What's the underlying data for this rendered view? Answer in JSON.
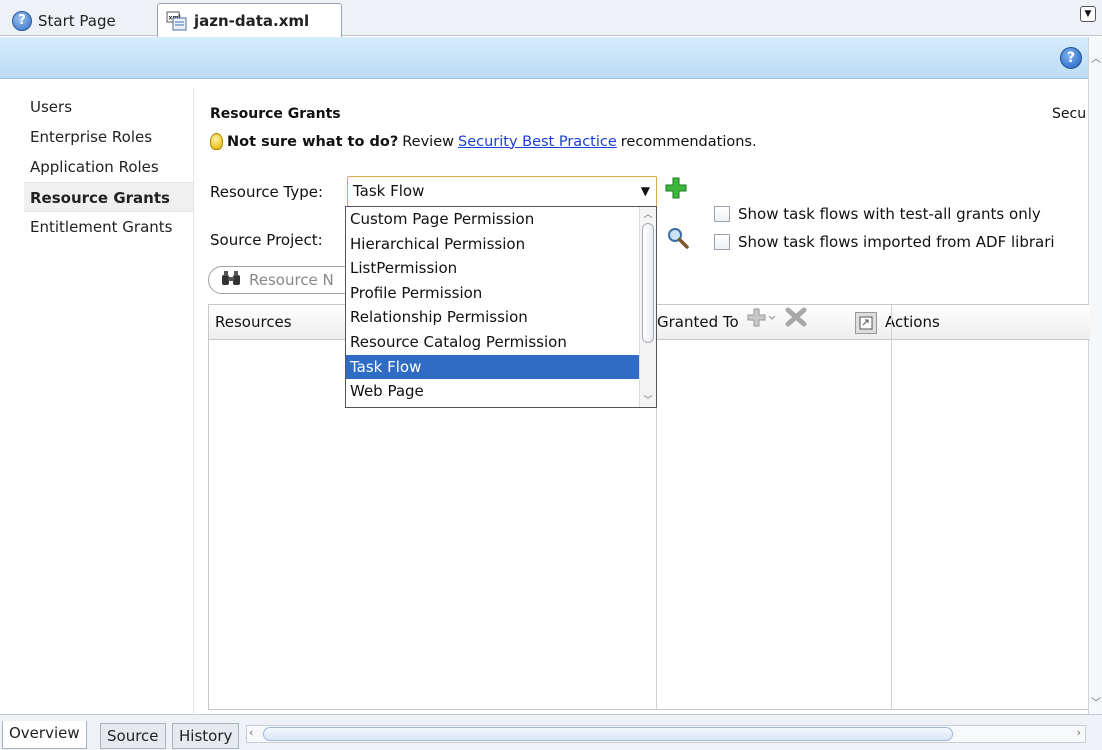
{
  "tabs": {
    "start_page": "Start Page",
    "jazn_data": "jazn-data.xml"
  },
  "sidebar": {
    "items": [
      {
        "label": "Users"
      },
      {
        "label": "Enterprise Roles"
      },
      {
        "label": "Application Roles"
      },
      {
        "label": "Resource Grants"
      },
      {
        "label": "Entitlement Grants"
      }
    ],
    "active": "Resource Grants"
  },
  "main": {
    "title": "Resource Grants",
    "right_label": "Secu",
    "hint_bold": "Not sure what to do?",
    "hint_review": "Review",
    "hint_link": "Security Best Practice",
    "hint_tail": "recommendations.",
    "resource_type_label": "Resource Type:",
    "resource_type_value": "Task Flow",
    "source_project_label": "Source Project:",
    "checkbox_test_all": "Show task flows with test-all grants only",
    "checkbox_imported": "Show task flows imported from ADF librari",
    "filter_placeholder": "Resource N"
  },
  "dropdown": {
    "options": [
      "Custom Page Permission",
      "Hierarchical Permission",
      "ListPermission",
      "Profile Permission",
      "Relationship Permission",
      "Resource Catalog Permission",
      "Task Flow",
      "Web Page"
    ],
    "selected": "Task Flow"
  },
  "table": {
    "columns": {
      "resources": "Resources",
      "granted_to": "Granted To",
      "actions": "Actions"
    }
  },
  "bottom_tabs": {
    "overview": "Overview",
    "source": "Source",
    "history": "History"
  },
  "colors": {
    "accent_blue": "#2f6cc6",
    "banner_blue": "#c8e3f8",
    "link": "#1a3fd6",
    "add_green": "#2fa82f"
  }
}
